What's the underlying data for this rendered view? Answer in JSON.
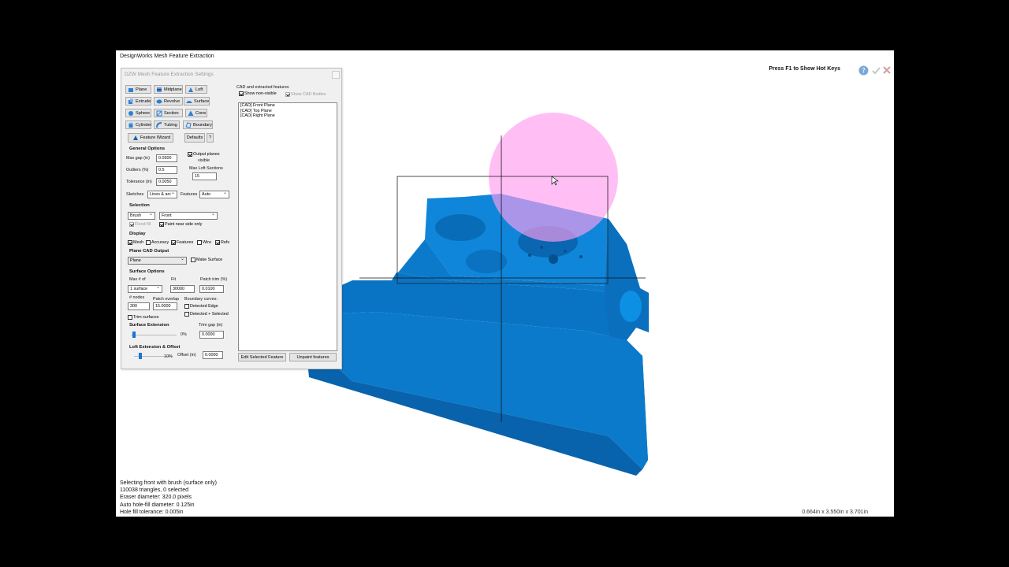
{
  "app_title": "DesignWorks Mesh Feature Extraction",
  "hotkeys_hint": "Press F1 to Show Hot Keys",
  "colors": {
    "mesh_blue": "#0b7fd1",
    "brush_pink": "#ff9cf0",
    "accent": "#1a73d6"
  },
  "panel": {
    "title": "DZW Mesh Feature Extraction Settings",
    "tools": [
      {
        "label": "Plane",
        "icon": "plane-icon"
      },
      {
        "label": "Midplane",
        "icon": "midplane-icon"
      },
      {
        "label": "Loft",
        "icon": "loft-icon"
      },
      {
        "label": "Extrude",
        "icon": "extrude-icon"
      },
      {
        "label": "Revolve",
        "icon": "revolve-icon"
      },
      {
        "label": "Surface",
        "icon": "surface-icon"
      },
      {
        "label": "Sphere",
        "icon": "sphere-icon"
      },
      {
        "label": "Section",
        "icon": "section-icon"
      },
      {
        "label": "Cone",
        "icon": "cone-icon"
      },
      {
        "label": "Cylinder",
        "icon": "cylinder-icon"
      },
      {
        "label": "Tubing",
        "icon": "tubing-icon"
      },
      {
        "label": "Boundary",
        "icon": "boundary-icon"
      }
    ],
    "feature_wizard": "Feature Wizard",
    "defaults": "Defaults",
    "help": "?",
    "general": {
      "heading": "General Options",
      "max_gap_label": "Max gap (in)",
      "max_gap": "0.0500",
      "outliers_label": "Outliers (%)",
      "outliers": "0.5",
      "tolerance_label": "Tolerance (in)",
      "tolerance": "0.0050",
      "output_planes_1": "Output planes",
      "output_planes_2": "visible",
      "max_loft_label": "Max Loft Sections",
      "max_loft": "15",
      "sketches_label": "Sketches",
      "sketches": "Lines & arc",
      "features_label": "Features",
      "features": "Auto"
    },
    "selection": {
      "heading": "Selection",
      "mode": "Brush",
      "target": "Front",
      "flood_fill": "Flood fill",
      "paint_near": "Paint near side only"
    },
    "display": {
      "heading": "Display",
      "items": [
        "Mesh",
        "Accuracy",
        "Features",
        "Wire",
        "Refs"
      ]
    },
    "plane_cad": {
      "heading": "Plane CAD Output",
      "type": "Plane",
      "make_surface": "Make Surface"
    },
    "surface": {
      "heading": "Surface Options",
      "max_label": "Max # of",
      "max": "1 surface",
      "fit_label": "Fit",
      "fit": "30000",
      "patch_trim_label": "Patch trim (%)",
      "patch_trim": "0.0100",
      "nodes_label": "# nodes",
      "nodes": "300",
      "patch_overlap_label": "Patch overlap",
      "patch_overlap": "15.0000",
      "boundary_label": "Boundary curves:",
      "detected_edge": "Detected Edge",
      "detected_selected": "Detected + Selected",
      "trim_surfaces": "Trim surfaces"
    },
    "extension": {
      "heading": "Surface Extension",
      "pct": "0%",
      "pct_level": 0,
      "trim_gap_label": "Trim gap (in)",
      "trim_gap": "0.0000"
    },
    "loft_ext": {
      "heading": "Loft Extension & Offset",
      "pct": "10%",
      "pct_level": 10,
      "offset_label": "Offset (in)",
      "offset": "0.0000"
    },
    "cad": {
      "heading": "CAD and extracted features",
      "show_nonvisible": "Show non-visible",
      "show_cad_bodies": "Show CAD Bodies",
      "items": [
        "[CAD] Front Plane",
        "[CAD] Top Plane",
        "[CAD] Right Plane"
      ],
      "edit_btn": "Edit Selected Feature",
      "unpaint_btn": "Unpaint features"
    }
  },
  "status": [
    "Selecting front with brush (surface only)",
    "110038 triangles, 0 selected",
    "Eraser diameter: 320.0 pixels",
    "Auto hole-fill diameter: 0.125in",
    "Hole fill tolerance: 0.005in"
  ],
  "dimensions": "0.664in x 3.550in x 3.701in"
}
